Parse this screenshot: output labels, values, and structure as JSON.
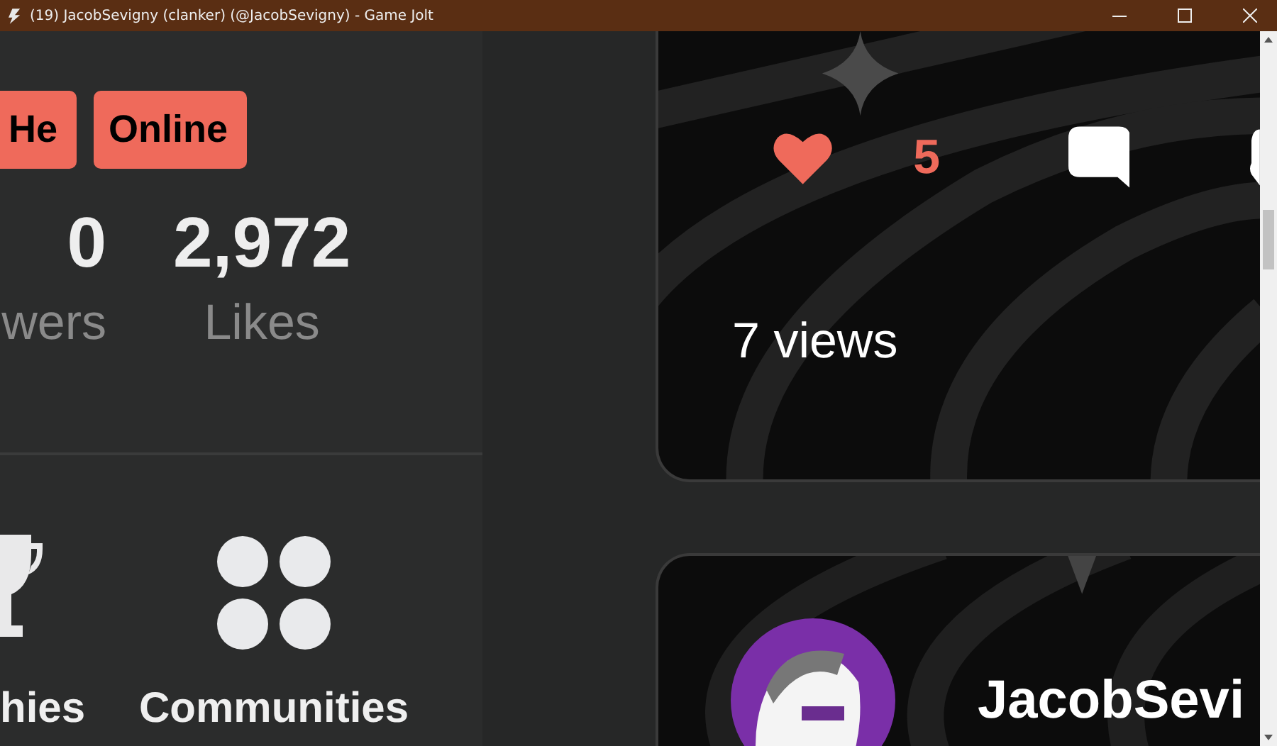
{
  "window": {
    "title": "(19) JacobSevigny (clanker) (@JacobSevigny) - Game Jolt"
  },
  "profile": {
    "tags": [
      "He",
      "Online"
    ],
    "stats": [
      {
        "value": "0",
        "label": "wers"
      },
      {
        "value": "2,972",
        "label": "Likes"
      }
    ],
    "links": [
      {
        "kind": "trophy",
        "label": "hies"
      },
      {
        "kind": "communities",
        "label": "Communities"
      }
    ]
  },
  "posts": [
    {
      "likes": "5",
      "liked": true,
      "views": "7 views"
    },
    {
      "author": "JacobSevi"
    }
  ]
}
